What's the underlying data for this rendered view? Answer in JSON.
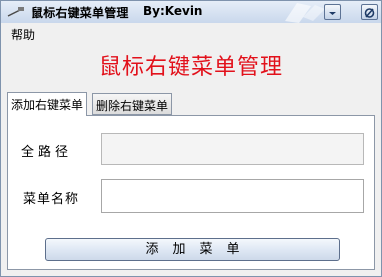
{
  "window": {
    "title": "鼠标右键菜单管理",
    "author": "By:Kevin"
  },
  "menu": {
    "help": "帮助"
  },
  "main": {
    "heading": "鼠标右键菜单管理"
  },
  "tabs": [
    {
      "label": "添加右键菜单",
      "active": true
    },
    {
      "label": "删除右键菜单",
      "active": false
    }
  ],
  "form": {
    "path_label": "全路径",
    "path_value": "",
    "name_label": "菜单名称",
    "name_value": "",
    "add_button": "添加菜单"
  },
  "colors": {
    "heading": "#e2111b",
    "titlebar": "#c9d8ec"
  },
  "icons": {
    "app": "mouse-cursor-icon",
    "minimize": "minimize-icon",
    "close": "close-icon"
  }
}
